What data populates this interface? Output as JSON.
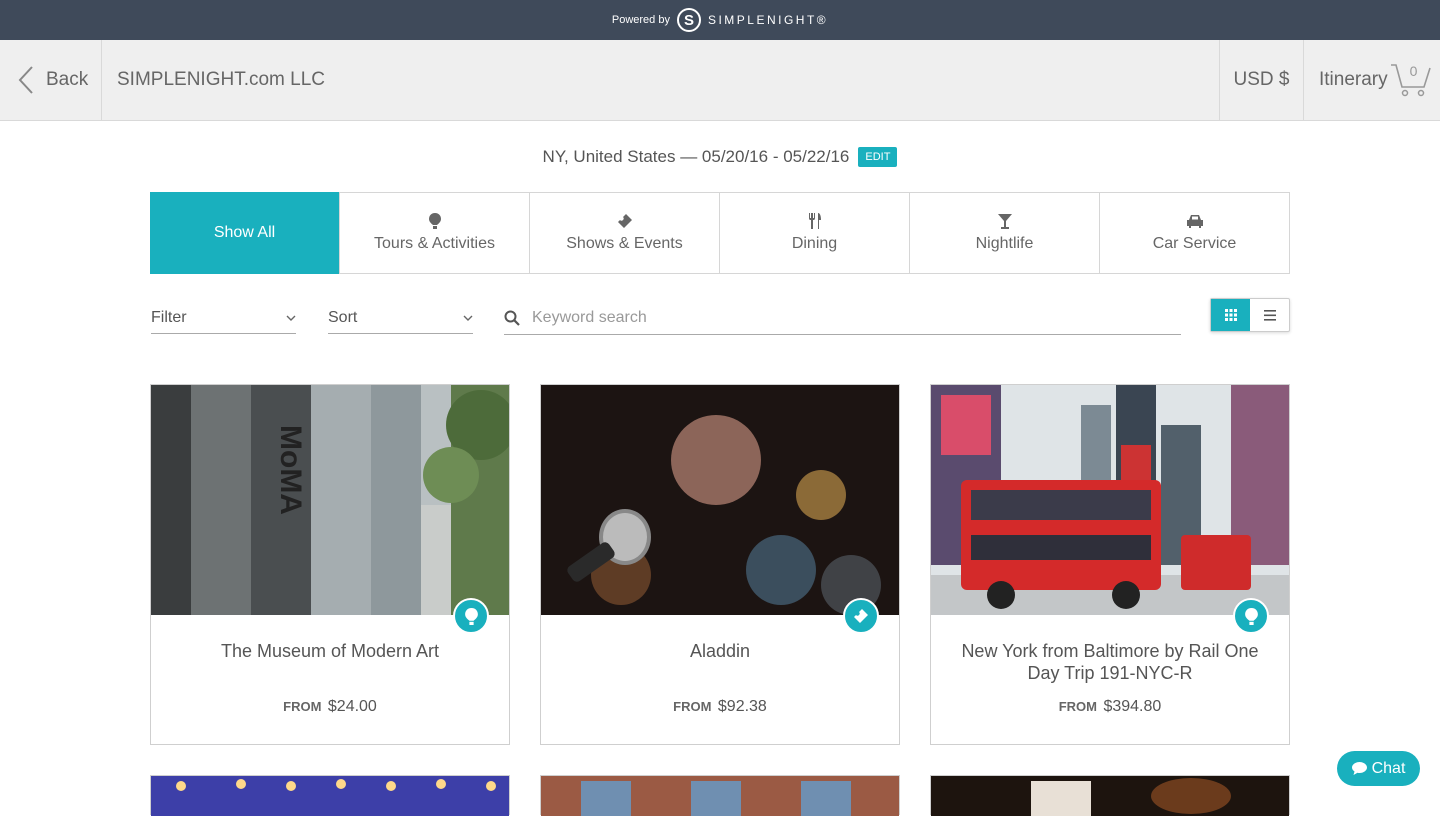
{
  "banner": {
    "powered_by": "Powered by",
    "brand": "SIMPLENIGHT®"
  },
  "header": {
    "back_label": "Back",
    "company": "SIMPLENIGHT.com LLC",
    "currency": "USD $",
    "itinerary_label": "Itinerary",
    "cart_count": "0"
  },
  "destination": {
    "text": "NY, United States — 05/20/16 - 05/22/16",
    "edit_label": "EDIT"
  },
  "tabs": [
    {
      "label": "Show All",
      "icon": "none",
      "active": true
    },
    {
      "label": "Tours & Activities",
      "icon": "hot-air-balloon-icon"
    },
    {
      "label": "Shows & Events",
      "icon": "ticket-icon"
    },
    {
      "label": "Dining",
      "icon": "fork-knife-icon"
    },
    {
      "label": "Nightlife",
      "icon": "cocktail-icon"
    },
    {
      "label": "Car Service",
      "icon": "car-icon"
    }
  ],
  "controls": {
    "filter_label": "Filter",
    "sort_label": "Sort",
    "search_placeholder": "Keyword search",
    "view_mode": "grid"
  },
  "cards": [
    {
      "title": "The Museum of Modern Art",
      "from_label": "FROM",
      "price": "$24.00",
      "category_icon": "hot-air-balloon-icon"
    },
    {
      "title": "Aladdin",
      "from_label": "FROM",
      "price": "$92.38",
      "category_icon": "ticket-icon"
    },
    {
      "title": "New York from Baltimore by Rail One Day Trip 191-NYC-R",
      "from_label": "FROM",
      "price": "$394.80",
      "category_icon": "hot-air-balloon-icon"
    }
  ],
  "chat": {
    "label": "Chat"
  },
  "colors": {
    "accent": "#19b0be",
    "banner_bg": "#3f4a5a",
    "header_bg": "#efefef"
  }
}
